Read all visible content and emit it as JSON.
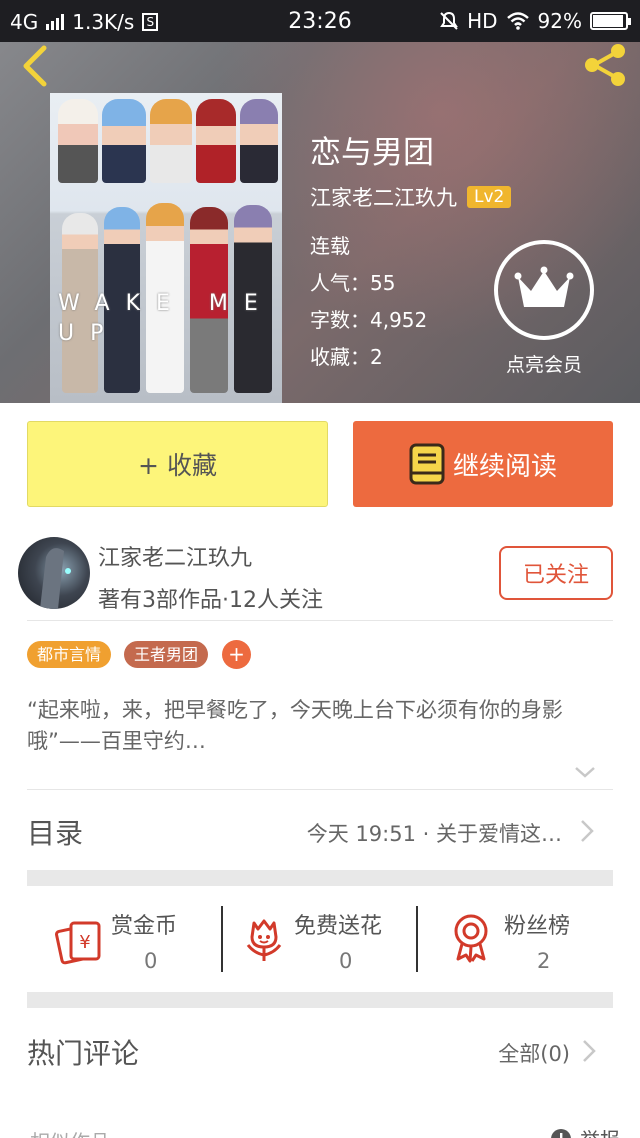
{
  "status_bar": {
    "network": "4G",
    "speed": "1.3K/s",
    "time": "23:26",
    "hd": "HD",
    "battery": "92%"
  },
  "book": {
    "title": "恋与男团",
    "author": "江家老二江玖九",
    "author_level": "Lv2",
    "status": "连载",
    "popularity": "人气：55",
    "word_count": "字数：4,952",
    "favorites": "收藏：2",
    "cover_text": "WAKE ME UP"
  },
  "vip": {
    "label": "点亮会员",
    "icon": "crown-icon"
  },
  "actions": {
    "favorite": "+ 收藏",
    "continue_reading": "继续阅读"
  },
  "author_card": {
    "name": "江家老二江玖九",
    "info": "著有3部作品·12人关注",
    "follow_label": "已关注"
  },
  "tags": [
    {
      "label": "都市言情",
      "color": "#f0a030"
    },
    {
      "label": "王者男团",
      "color": "#c46a4e"
    }
  ],
  "tag_add": "+",
  "synopsis": "“起来啦，来，把早餐吃了，今天晚上台下必须有你的身影哦”——百里守约…",
  "toc": {
    "label": "目录",
    "latest": "今天 19:51 · 关于爱情这…"
  },
  "stats": [
    {
      "label": "赏金币",
      "value": "0",
      "icon": "envelope-coin-icon"
    },
    {
      "label": "免费送花",
      "value": "0",
      "icon": "flower-icon"
    },
    {
      "label": "粉丝榜",
      "value": "2",
      "icon": "medal-icon"
    }
  ],
  "comments": {
    "title": "热门评论",
    "all": "全部(0)"
  },
  "bottom": {
    "left": "相似作品",
    "right": "举报"
  },
  "colors": {
    "accent_orange": "#ed6a3f",
    "favorite_yellow": "#fdf57a",
    "follow_red": "#e0553a",
    "level_badge": "#f0b62e",
    "icon_red": "#d23a2a"
  }
}
